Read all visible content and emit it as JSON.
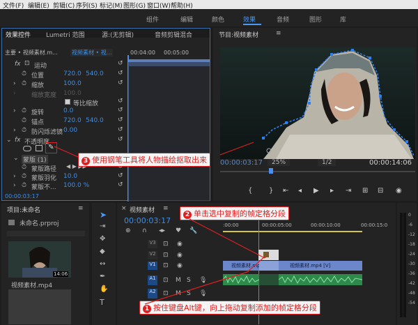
{
  "menu": [
    "文件(F)",
    "编辑(E)",
    "剪辑(C)",
    "序列(S)",
    "标记(M)",
    "图形(G)",
    "窗口(W)",
    "帮助(H)"
  ],
  "workspaces": [
    "组件",
    "编辑",
    "颜色",
    "效果",
    "音频",
    "图形",
    "库"
  ],
  "effect_controls": {
    "tabs": [
      "效果控件",
      "Lumetri 范围",
      "源:(无剪辑)",
      "音频剪辑混合"
    ],
    "clip_master": "主要 • 视频素材.m...",
    "clip_sequence": "视频素材 • 视...",
    "ruler_start": "00:04:00",
    "ruler_end": "00:05:00",
    "section_motion": "运动",
    "position_label": "位置",
    "position_x": "720.0",
    "position_y": "540.0",
    "scale_label": "缩放",
    "scale_value": "100.0",
    "scale_width_label": "缩放宽度",
    "uniform_scale_label": "等比缩放",
    "rotation_label": "旋转",
    "rotation_value": "0.0",
    "anchor_label": "锚点",
    "anchor_x": "720.0",
    "anchor_y": "540.0",
    "antiflicker_label": "防闪烁滤镜",
    "antiflicker_value": "0.00",
    "section_opacity": "不透明度",
    "mask_label": "蒙版 (1)",
    "mask_path_label": "蒙版路径",
    "mask_feather_label": "蒙版羽化",
    "mask_feather_value": "10.0",
    "mask_opacity_label": "蒙版不...",
    "mask_opacity_value": "100.0 %",
    "timecode": "00:00:03:17"
  },
  "program": {
    "title": "节目:视频素材",
    "timecode": "00:00:03:17",
    "zoom": "25%",
    "resolution": "1/2",
    "duration": "00:00:14:06"
  },
  "project": {
    "title": "项目:未命名",
    "file": "未命名.prproj",
    "media_label": "视频素材.mp4",
    "media_duration": "14:06"
  },
  "timeline": {
    "title": "视频素材",
    "timecode": "00:00:03:17",
    "ruler": [
      ":00:00",
      "00:00:05:00",
      "00:00:10:00",
      "00:00:15:0"
    ],
    "video_tracks": [
      "V3",
      "V2",
      "V1"
    ],
    "audio_tracks": [
      "A1",
      "A2",
      "A3"
    ],
    "clip_label": "视频素材.mp4",
    "clip_label_2": "视频素材.mp4 [V]",
    "track_btn_m": "M",
    "track_btn_s": "S"
  },
  "meter_labels": [
    "0",
    "-6",
    "-12",
    "-18",
    "-24",
    "-30",
    "-36",
    "-42",
    "-48",
    "-54"
  ],
  "callouts": [
    {
      "num": "3",
      "text": "使用钢笔工具将人物描绘抠取出来"
    },
    {
      "num": "2",
      "text": "单击选中复制的帧定格分段"
    },
    {
      "num": "1",
      "text": "按住键盘Alt键，向上拖动复制添加的帧定格分段"
    }
  ],
  "colors": {
    "accent": "#3e8ee7",
    "callout": "#e02020",
    "mask": "#2f7ff0",
    "playhead": "#4a8ef0"
  }
}
